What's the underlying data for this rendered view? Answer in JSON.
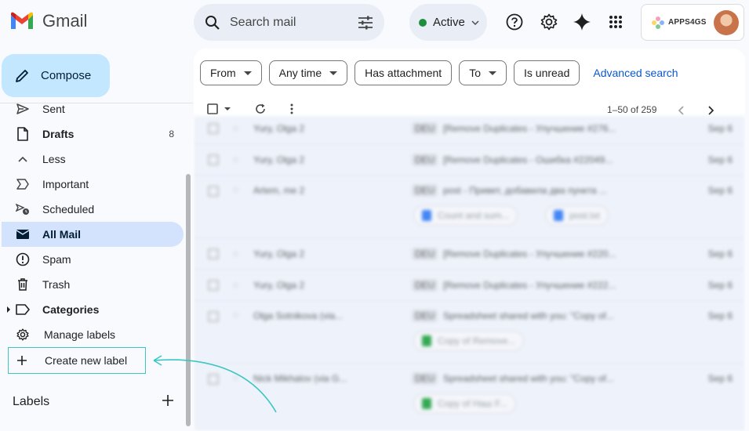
{
  "app": {
    "name": "Gmail"
  },
  "search": {
    "placeholder": "Search mail"
  },
  "status": {
    "label": "Active"
  },
  "account": {
    "brand": "APPS4GS"
  },
  "compose": {
    "label": "Compose"
  },
  "nav": {
    "items": [
      {
        "label": "Sent",
        "icon": "send-icon",
        "bold": false
      },
      {
        "label": "Drafts",
        "icon": "draft-icon",
        "bold": true,
        "count": "8"
      },
      {
        "label": "Less",
        "icon": "chevron-up-icon",
        "bold": false
      },
      {
        "label": "Important",
        "icon": "important-icon",
        "bold": false
      },
      {
        "label": "Scheduled",
        "icon": "scheduled-icon",
        "bold": false
      },
      {
        "label": "All Mail",
        "icon": "all-mail-icon",
        "bold": true,
        "active": true
      },
      {
        "label": "Spam",
        "icon": "spam-icon",
        "bold": false
      },
      {
        "label": "Trash",
        "icon": "trash-icon",
        "bold": false
      },
      {
        "label": "Categories",
        "icon": "label-icon",
        "bold": true
      },
      {
        "label": "Manage labels",
        "icon": "gear-icon",
        "bold": false
      }
    ],
    "create_label": "Create new label",
    "labels_header": "Labels"
  },
  "filters": {
    "from": "From",
    "any_time": "Any time",
    "has_attachment": "Has attachment",
    "to": "To",
    "is_unread": "Is unread",
    "advanced": "Advanced search"
  },
  "toolbar": {
    "pager": "1–50 of 259"
  },
  "emails": [
    {
      "sender": "Yury, Olga 2",
      "tag": "DEU",
      "subject": "[Remove Duplicates - Улучшение #276...",
      "date": "Sep 6"
    },
    {
      "sender": "Yury, Olga 2",
      "tag": "DEU",
      "subject": "[Remove Duplicates - Ошибка #22049...",
      "date": "Sep 6"
    },
    {
      "sender": "Artem, me 2",
      "tag": "DEU",
      "subject": "post - Привет, добавила два пункта ...",
      "date": "Sep 6",
      "attachments": [
        "Count and sum...",
        "post.txt"
      ]
    },
    {
      "sender": "Yury, Olga 2",
      "tag": "DEU",
      "subject": "[Remove Duplicates - Улучшение #220...",
      "date": "Sep 6"
    },
    {
      "sender": "Yury, Olga 2",
      "tag": "DEU",
      "subject": "[Remove Duplicates - Улучшение #222...",
      "date": "Sep 6"
    },
    {
      "sender": "Olga Sotnikova (via...",
      "tag": "DEU",
      "subject": "Spreadsheet shared with you: \"Copy of...",
      "date": "Sep 6",
      "attachments": [
        "Copy of Remove..."
      ]
    },
    {
      "sender": "Nick Mikhalov (via G...",
      "tag": "DEU",
      "subject": "Spreadsheet shared with you: \"Copy of...",
      "date": "Sep 6",
      "attachments": [
        "Copy of Наш F..."
      ]
    }
  ],
  "colors": {
    "accent": "#0b57d0",
    "compose": "#c2e7ff",
    "active_nav": "#d3e3fd",
    "highlight": "#3bc6c2"
  }
}
